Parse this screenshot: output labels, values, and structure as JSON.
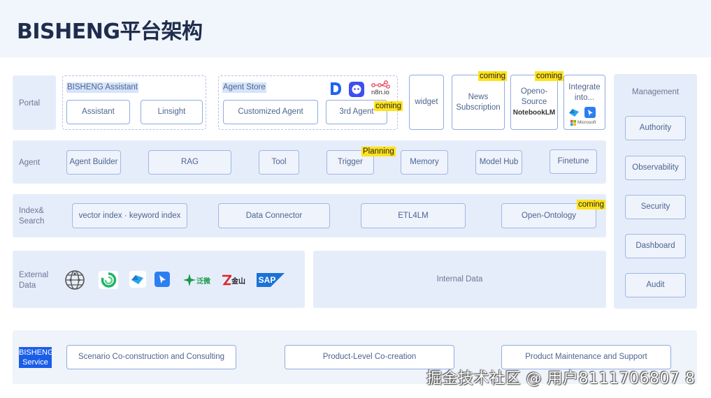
{
  "title": "BISHENG平台架构",
  "rows": {
    "portal": "Portal",
    "agent": "Agent",
    "index_line1": "Index&",
    "index_line2": "Search",
    "external_line1": "External",
    "external_line2": "Data",
    "service_line1": "BISHENG",
    "service_line2": "Service"
  },
  "portal": {
    "assistant_group": "BISHENG Assistant",
    "assistant": "Assistant",
    "linsight": "Linsight",
    "store_group": "Agent Store",
    "customized_agent": "Customized Agent",
    "third_agent": "3rd Agent",
    "n8n": "n8n.io",
    "widget": "widget",
    "news_line1": "News",
    "news_line2": "Subscription",
    "openo_line1": "Openo-",
    "openo_line2": "Source",
    "openo_line3": "NotebookLM",
    "integrate_line1": "Integrate",
    "integrate_line2": "into...",
    "microsoft": "Microsoft"
  },
  "agent": {
    "items": [
      "Agent Builder",
      "RAG",
      "Tool",
      "Trigger",
      "Memory",
      "Model Hub",
      "Finetune"
    ]
  },
  "index": {
    "vector": "vector index · keyword index",
    "connector": "Data Connector",
    "etl": "ETL4LM",
    "ontology": "Open-Ontology"
  },
  "external": {
    "internal_data": "Internal Data",
    "fanwei": "泛微",
    "kingsoft": "金山",
    "sap": "SAP"
  },
  "management": {
    "title": "Management",
    "items": [
      "Authority",
      "Observability",
      "Security",
      "Dashboard",
      "Audit"
    ]
  },
  "service": {
    "items": [
      "Scenario Co-construction and Consulting",
      "Product-Level Co-creation",
      "Product Maintenance and Support"
    ]
  },
  "tags": {
    "coming": "coming",
    "planning": "Planning"
  },
  "watermark": "掘金技术社区 @ 用户8111706807 8"
}
